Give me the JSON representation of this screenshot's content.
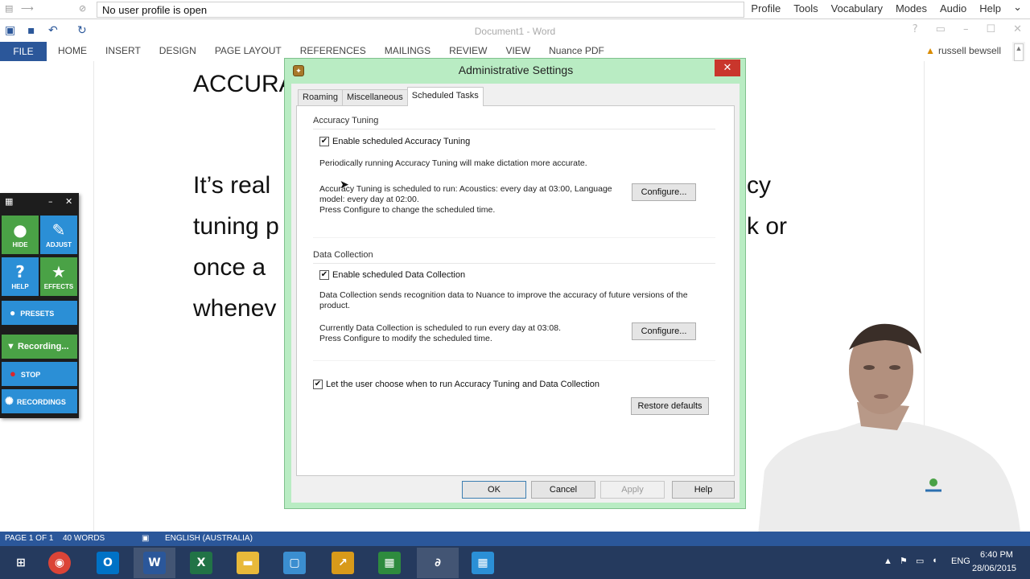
{
  "dragon_bar": {
    "profile_text": "No user profile is open",
    "menu": [
      "Profile",
      "Tools",
      "Vocabulary",
      "Modes",
      "Audio",
      "Help"
    ]
  },
  "word": {
    "title": "Document1 - Word",
    "file_tab": "FILE",
    "tabs": [
      "HOME",
      "INSERT",
      "DESIGN",
      "PAGE LAYOUT",
      "REFERENCES",
      "MAILINGS",
      "REVIEW",
      "VIEW",
      "Nuance PDF"
    ],
    "user": "russell bewsell"
  },
  "document": {
    "heading": "ACCURA",
    "lines_left": [
      "It’s real",
      "tuning p",
      "once a",
      "whenev"
    ],
    "lines_right": [
      "cy",
      "k or"
    ]
  },
  "dragonbar_widget": {
    "tiles": [
      "HIDE",
      "ADJUST",
      "HELP",
      "EFFECTS"
    ],
    "presets": "PRESETS",
    "recording": "Recording...",
    "stop": "STOP",
    "recordings": "RECORDINGS"
  },
  "dialog": {
    "title": "Administrative Settings",
    "tabs": [
      "Roaming",
      "Miscellaneous",
      "Scheduled Tasks"
    ],
    "active_tab": "Scheduled Tasks",
    "accuracy": {
      "group_label": "Accuracy Tuning",
      "checkbox_label": "Enable scheduled Accuracy Tuning",
      "checked": true,
      "description": "Periodically running Accuracy Tuning will make dictation more accurate.",
      "schedule_line1": "Accuracy Tuning is scheduled to run: Acoustics: every day at 03:00, Language",
      "schedule_line2": "model: every day at 02:00.",
      "schedule_line3": "Press Configure to change the scheduled time.",
      "configure": "Configure..."
    },
    "collection": {
      "group_label": "Data Collection",
      "checkbox_label": "Enable scheduled Data Collection",
      "checked": true,
      "description_line1": "Data Collection sends recognition data to Nuance to improve the accuracy of future versions of the",
      "description_line2": "product.",
      "schedule_line1": "Currently Data Collection is scheduled to run every day at 03:08.",
      "schedule_line2": "Press Configure to modify the scheduled time.",
      "configure": "Configure..."
    },
    "user_choose_label": "Let the user choose when to run Accuracy Tuning and Data Collection",
    "user_choose_checked": true,
    "restore_defaults": "Restore defaults",
    "buttons": {
      "ok": "OK",
      "cancel": "Cancel",
      "apply": "Apply",
      "help": "Help"
    }
  },
  "status_bar": {
    "page": "PAGE 1 OF 1",
    "words": "40 WORDS",
    "language": "ENGLISH (AUSTRALIA)"
  },
  "taskbar": {
    "apps": [
      "start-button",
      "chrome",
      "outlook",
      "word",
      "excel",
      "file-explorer",
      "remote-desktop",
      "stocks",
      "calculator",
      "dragon",
      "dragon-bar"
    ],
    "lang": "ENG",
    "time": "6:40 PM",
    "date": "28/06/2015"
  },
  "colors": {
    "word_blue": "#2b579a",
    "dialog_frame": "#b9ecc3",
    "close_red": "#c9362c",
    "taskbar": "#253a5e"
  }
}
